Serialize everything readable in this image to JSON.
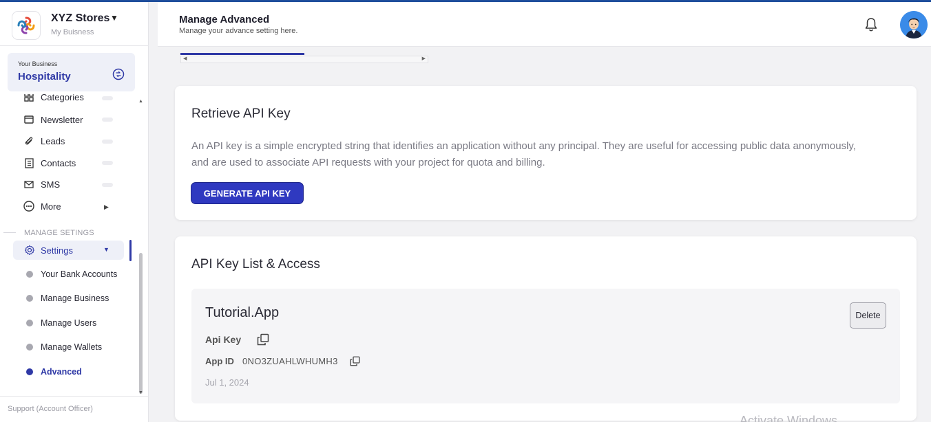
{
  "brand": {
    "name": "XYZ Stores",
    "subtitle": "My Buisness"
  },
  "business_card": {
    "label": "Your Business",
    "name": "Hospitality"
  },
  "nav": {
    "items": [
      {
        "label": "Categories",
        "icon": "grid-icon"
      },
      {
        "label": "Newsletter",
        "icon": "card-icon"
      },
      {
        "label": "Leads",
        "icon": "paperclip-icon"
      },
      {
        "label": "Contacts",
        "icon": "contacts-book-icon"
      },
      {
        "label": "SMS",
        "icon": "mail-icon"
      },
      {
        "label": "More",
        "icon": "more-circle-icon"
      }
    ],
    "section_title": "MANAGE SETINGS",
    "settings_label": "Settings",
    "sub_items": [
      {
        "label": "Your Bank Accounts"
      },
      {
        "label": "Manage Business"
      },
      {
        "label": "Manage Users"
      },
      {
        "label": "Manage Wallets"
      },
      {
        "label": "Advanced",
        "active": true
      }
    ],
    "support": "Support (Account Officer)"
  },
  "header": {
    "title": "Manage Advanced",
    "subtitle": "Manage your advance setting here."
  },
  "retrieve": {
    "title": "Retrieve API Key",
    "description": "An API key is a simple encrypted string that identifies an application without any principal. They are useful for accessing public data anonymously, and are used to associate API requests with your project for quota and billing.",
    "button": "GENERATE API KEY"
  },
  "api_list": {
    "title": "API Key List & Access",
    "entry": {
      "app_name": "Tutorial.App",
      "api_key_label": "Api Key",
      "app_id_label": "App ID",
      "app_id": "0NO3ZUAHLWHUMH3",
      "date": "Jul 1, 2024",
      "delete_label": "Delete"
    }
  },
  "watermark": "Activate Windows",
  "colors": {
    "accent": "#2f39a6",
    "button": "#2f39c0",
    "topline": "#1f4e9c"
  }
}
